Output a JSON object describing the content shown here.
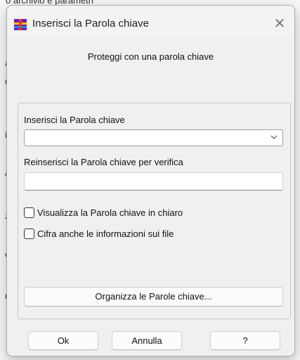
{
  "background": {
    "partial_text": "o archivio e parametri",
    "edge_chars": [
      "a",
      "r",
      "i",
      "A",
      "z",
      "e",
      "r"
    ]
  },
  "dialog": {
    "title": "Inserisci la Parola chiave",
    "app_icon": "winrar-icon",
    "close_glyph": "✕",
    "heading": "Proteggi con una parola chiave",
    "password_label": "Inserisci la Parola chiave",
    "password_value": "",
    "confirm_label": "Reinserisci la Parola chiave per verifica",
    "confirm_value": "",
    "show_password_label": "Visualizza la Parola chiave in chiaro",
    "show_password_checked": false,
    "encrypt_names_label": "Cifra anche le informazioni sui file",
    "encrypt_names_checked": false,
    "organize_button": "Organizza le Parole chiave...",
    "ok_button": "Ok",
    "cancel_button": "Annulla",
    "help_button": "?"
  },
  "colors": {
    "dialog_bg": "#f0f0f0",
    "border": "#a9a9a9",
    "button_bg": "#fbfbfb"
  }
}
